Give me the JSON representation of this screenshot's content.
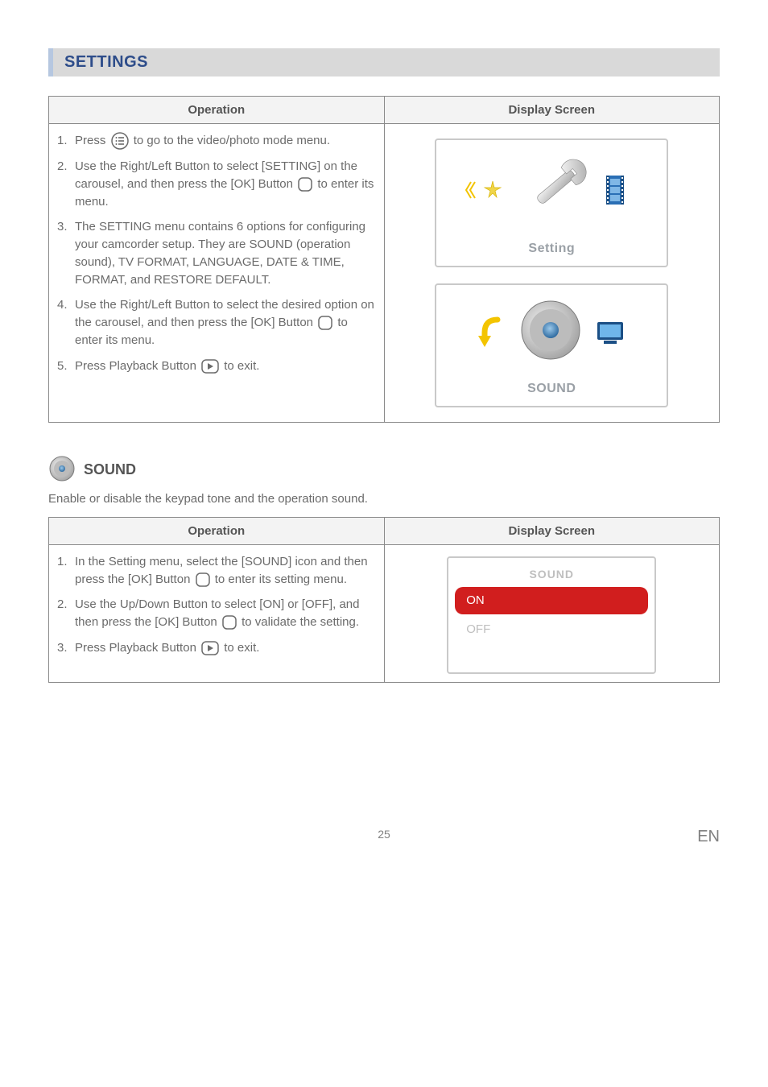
{
  "title": "SETTINGS",
  "table1": {
    "headers": {
      "op": "Operation",
      "disp": "Display Screen"
    },
    "steps": [
      {
        "num": "1.",
        "pre": "Press ",
        "post": " to go to the video/photo mode menu."
      },
      {
        "num": "2.",
        "pre": "Use the Right/Left Button to select [SETTING] on the carousel, and then press the [OK] Button ",
        "post": " to enter its menu."
      },
      {
        "num": "3.",
        "pre": "The SETTING menu contains 6 options for configuring your camcorder setup. They are SOUND (operation sound), TV FORMAT, LANGUAGE, DATE & TIME, FORMAT, and RESTORE DEFAULT.",
        "post": ""
      },
      {
        "num": "4.",
        "pre": "Use the Right/Left Button to select the desired option on the carousel, and then press the [OK] Button ",
        "post": " to enter its menu."
      },
      {
        "num": "5.",
        "pre": "Press Playback Button ",
        "post": " to exit."
      }
    ],
    "screens": {
      "setting_label": "Setting",
      "sound_label": "SOUND"
    }
  },
  "sound_section": {
    "heading": "SOUND",
    "desc": "Enable or disable the keypad tone and the operation sound."
  },
  "table2": {
    "headers": {
      "op": "Operation",
      "disp": "Display Screen"
    },
    "steps": [
      {
        "num": "1.",
        "pre": "In the Setting menu, select the [SOUND] icon and then press the [OK] Button ",
        "post": " to enter its setting menu."
      },
      {
        "num": "2.",
        "pre": "Use the Up/Down Button to select [ON] or [OFF], and then press the [OK] Button ",
        "post": " to validate the setting."
      },
      {
        "num": "3.",
        "pre": "Press Playback Button ",
        "post": " to exit."
      }
    ],
    "sound_menu": {
      "title": "SOUND",
      "on": "ON",
      "off": "OFF"
    }
  },
  "footer": {
    "page": "25",
    "lang": "EN"
  }
}
